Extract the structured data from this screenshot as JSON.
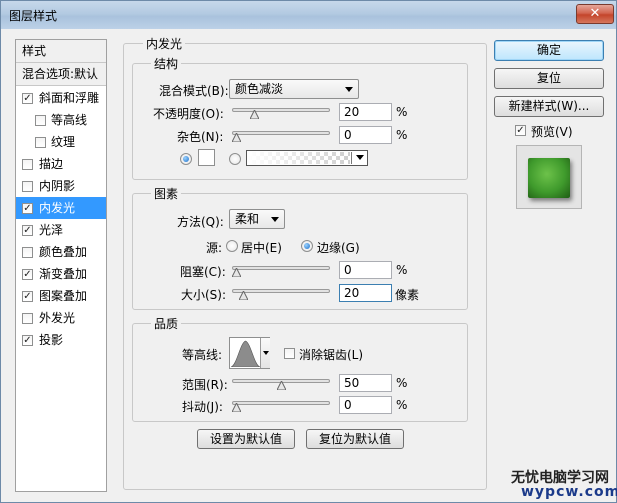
{
  "window": {
    "title": "图层样式",
    "close_glyph": "✕"
  },
  "sidebar": {
    "items": [
      {
        "label": "样式",
        "checkbox": false,
        "checked": false
      },
      {
        "label": "混合选项:默认",
        "checkbox": false,
        "checked": false
      },
      {
        "label": "斜面和浮雕",
        "checkbox": true,
        "checked": true
      },
      {
        "label": "等高线",
        "checkbox": true,
        "checked": false
      },
      {
        "label": "纹理",
        "checkbox": true,
        "checked": false
      },
      {
        "label": "描边",
        "checkbox": true,
        "checked": false
      },
      {
        "label": "内阴影",
        "checkbox": true,
        "checked": false
      },
      {
        "label": "内发光",
        "checkbox": true,
        "checked": true,
        "selected": true
      },
      {
        "label": "光泽",
        "checkbox": true,
        "checked": true
      },
      {
        "label": "颜色叠加",
        "checkbox": true,
        "checked": false
      },
      {
        "label": "渐变叠加",
        "checkbox": true,
        "checked": true
      },
      {
        "label": "图案叠加",
        "checkbox": true,
        "checked": true
      },
      {
        "label": "外发光",
        "checkbox": true,
        "checked": false
      },
      {
        "label": "投影",
        "checkbox": true,
        "checked": true
      }
    ]
  },
  "panel": {
    "title": "内发光",
    "structure": {
      "title": "结构",
      "blend_mode_label": "混合模式(B):",
      "blend_mode_value": "颜色减淡",
      "opacity_label": "不透明度(O):",
      "opacity_value": "20",
      "opacity_unit": "%",
      "opacity_fraction": 0.2,
      "noise_label": "杂色(N):",
      "noise_value": "0",
      "noise_unit": "%",
      "noise_fraction": 0.0,
      "color_radio_selected": "solid",
      "solid_color": "#ffffff"
    },
    "elements": {
      "title": "图素",
      "method_label": "方法(Q):",
      "method_value": "柔和",
      "source_label": "源:",
      "source_center": "居中(E)",
      "source_edge": "边缘(G)",
      "source_selected": "edge",
      "choke_label": "阻塞(C):",
      "choke_value": "0",
      "choke_unit": "%",
      "choke_fraction": 0.0,
      "size_label": "大小(S):",
      "size_value": "20",
      "size_unit": "像素",
      "size_fraction": 0.08
    },
    "quality": {
      "title": "品质",
      "contour_label": "等高线:",
      "antialias_label": "消除锯齿(L)",
      "antialias_checked": false,
      "range_label": "范围(R):",
      "range_value": "50",
      "range_unit": "%",
      "range_fraction": 0.5,
      "jitter_label": "抖动(J):",
      "jitter_value": "0",
      "jitter_unit": "%",
      "jitter_fraction": 0.0
    },
    "make_default": "设置为默认值",
    "reset_default": "复位为默认值"
  },
  "actions": {
    "ok": "确定",
    "reset": "复位",
    "new_style": "新建样式(W)...",
    "preview_label": "预览(V)",
    "preview_checked": true
  },
  "watermark": {
    "line1": "无忧电脑学习网",
    "line2": "wypcw.com"
  },
  "colors": {
    "selection": "#3399ff",
    "preview_green": "#3f9a2c"
  }
}
